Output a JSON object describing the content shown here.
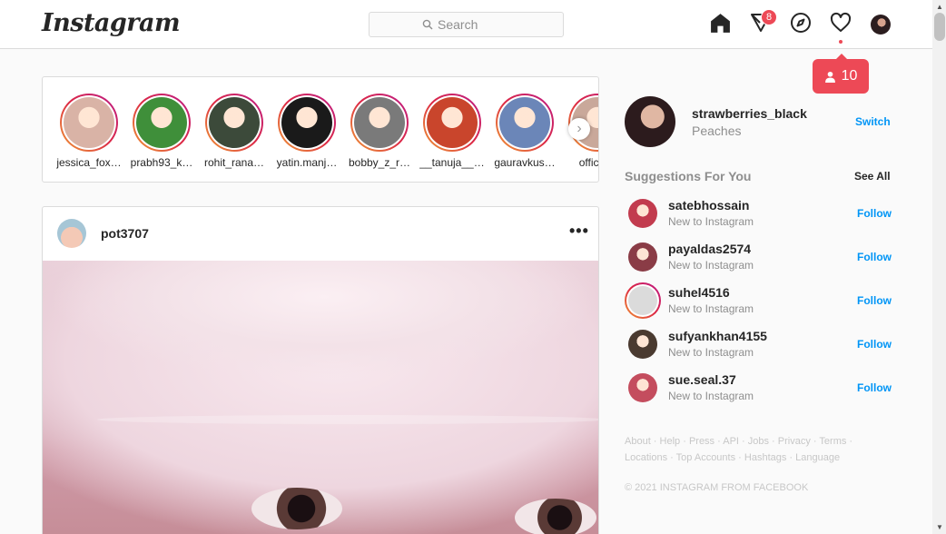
{
  "header": {
    "logo": "Instagram",
    "search_placeholder": "Search",
    "direct_badge": "8",
    "activity_count": "10"
  },
  "stories": [
    {
      "name": "jessica_fox…",
      "bg": "#d9b3a6"
    },
    {
      "name": "prabh93_k…",
      "bg": "#3f8f3a"
    },
    {
      "name": "rohit_rana…",
      "bg": "#3c4a3a"
    },
    {
      "name": "yatin.manj…",
      "bg": "#1a1a1a"
    },
    {
      "name": "bobby_z_r…",
      "bg": "#7a7a7a"
    },
    {
      "name": "__tanuja__…",
      "bg": "#c9452c"
    },
    {
      "name": "gauravkus…",
      "bg": "#6b86b8"
    },
    {
      "name": "official_",
      "bg": "#c9a89a"
    }
  ],
  "post": {
    "username": "pot3707",
    "more": "•••"
  },
  "current_user": {
    "username": "strawberries_black",
    "name": "Peaches",
    "switch": "Switch"
  },
  "suggestions": {
    "title": "Suggestions For You",
    "see_all": "See All",
    "items": [
      {
        "username": "satebhossain",
        "sub": "New to Instagram",
        "action": "Follow",
        "bg": "#c23b4e"
      },
      {
        "username": "payaldas2574",
        "sub": "New to Instagram",
        "action": "Follow",
        "bg": "#8a3c46"
      },
      {
        "username": "suhel4516",
        "sub": "New to Instagram",
        "action": "Follow",
        "bg": "#dbdbdb"
      },
      {
        "username": "sufyankhan4155",
        "sub": "New to Instagram",
        "action": "Follow",
        "bg": "#4a3a30"
      },
      {
        "username": "sue.seal.37",
        "sub": "New to Instagram",
        "action": "Follow",
        "bg": "#c44d5e"
      }
    ]
  },
  "footer": {
    "line1": [
      "About",
      "Help",
      "Press",
      "API",
      "Jobs",
      "Privacy",
      "Terms"
    ],
    "line2": [
      "Locations",
      "Top Accounts",
      "Hashtags",
      "Language"
    ],
    "copyright": "© 2021 INSTAGRAM FROM FACEBOOK"
  }
}
